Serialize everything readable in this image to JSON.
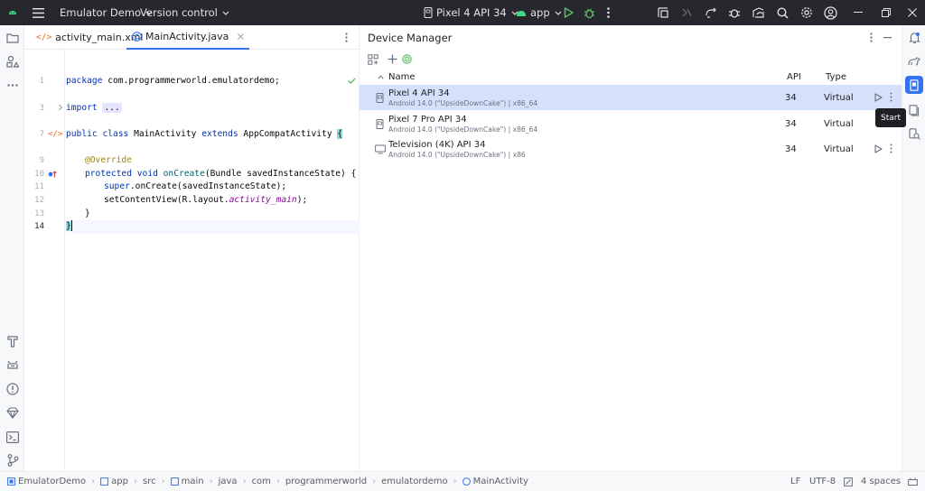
{
  "colors": {
    "title_bg": "#27282e",
    "accent": "#3574f0",
    "selection": "#d5e1fb",
    "android_green": "#3ddc84",
    "run_green": "#5fb865"
  },
  "titlebar": {
    "project_name": "Emulator Demo",
    "vcs_label": "Version control",
    "device_selector": "Pixel 4 API 34",
    "run_config": "app"
  },
  "editor": {
    "tabs": [
      {
        "label": "activity_main.xml",
        "icon": "xml-file-icon",
        "active": false
      },
      {
        "label": "MainActivity.java",
        "icon": "java-class-icon",
        "active": true
      }
    ],
    "line_numbers": [
      "1",
      "3",
      "7",
      "9",
      "10",
      "11",
      "12",
      "13",
      "14"
    ],
    "lines": {
      "l1_kw": "package",
      "l1_rest": " com.programmerworld.emulatordemo;",
      "l3_kw": "import",
      "l3_fold": "...",
      "l7_kw1": "public",
      "l7_kw2": "class",
      "l7_name": "MainActivity",
      "l7_kw3": "extends",
      "l7_super": "AppCompatActivity",
      "l7_brace": "{",
      "l9_ann": "@Override",
      "l10_kw1": "protected",
      "l10_kw2": "void",
      "l10_fn": "onCreate",
      "l10_rest": "(Bundle savedInstanceState) {",
      "l11_kw": "super",
      "l11_rest": ".onCreate(savedInstanceState);",
      "l12_pre": "setContentView(R.layout.",
      "l12_it": "activity_main",
      "l12_post": ");",
      "l13": "}",
      "l14": "}"
    }
  },
  "device_manager": {
    "title": "Device Manager",
    "columns": {
      "name": "Name",
      "api": "API",
      "type": "Type"
    },
    "devices": [
      {
        "name": "Pixel 4 API 34",
        "details": "Android 14.0 (\"UpsideDownCake\") | x86_64",
        "api": "34",
        "type": "Virtual",
        "selected": true
      },
      {
        "name": "Pixel 7 Pro API 34",
        "details": "Android 14.0 (\"UpsideDownCake\") | x86_64",
        "api": "34",
        "type": "Virtual",
        "selected": false
      },
      {
        "name": "Television (4K) API 34",
        "details": "Android 14.0 (\"UpsideDownCake\") | x86",
        "api": "34",
        "type": "Virtual",
        "selected": false
      }
    ],
    "tooltip": "Start"
  },
  "statusbar": {
    "breadcrumb": [
      "EmulatorDemo",
      "app",
      "src",
      "main",
      "java",
      "com",
      "programmerworld",
      "emulatordemo",
      "MainActivity"
    ],
    "line_separator": "LF",
    "encoding": "UTF-8",
    "indent": "4 spaces"
  }
}
